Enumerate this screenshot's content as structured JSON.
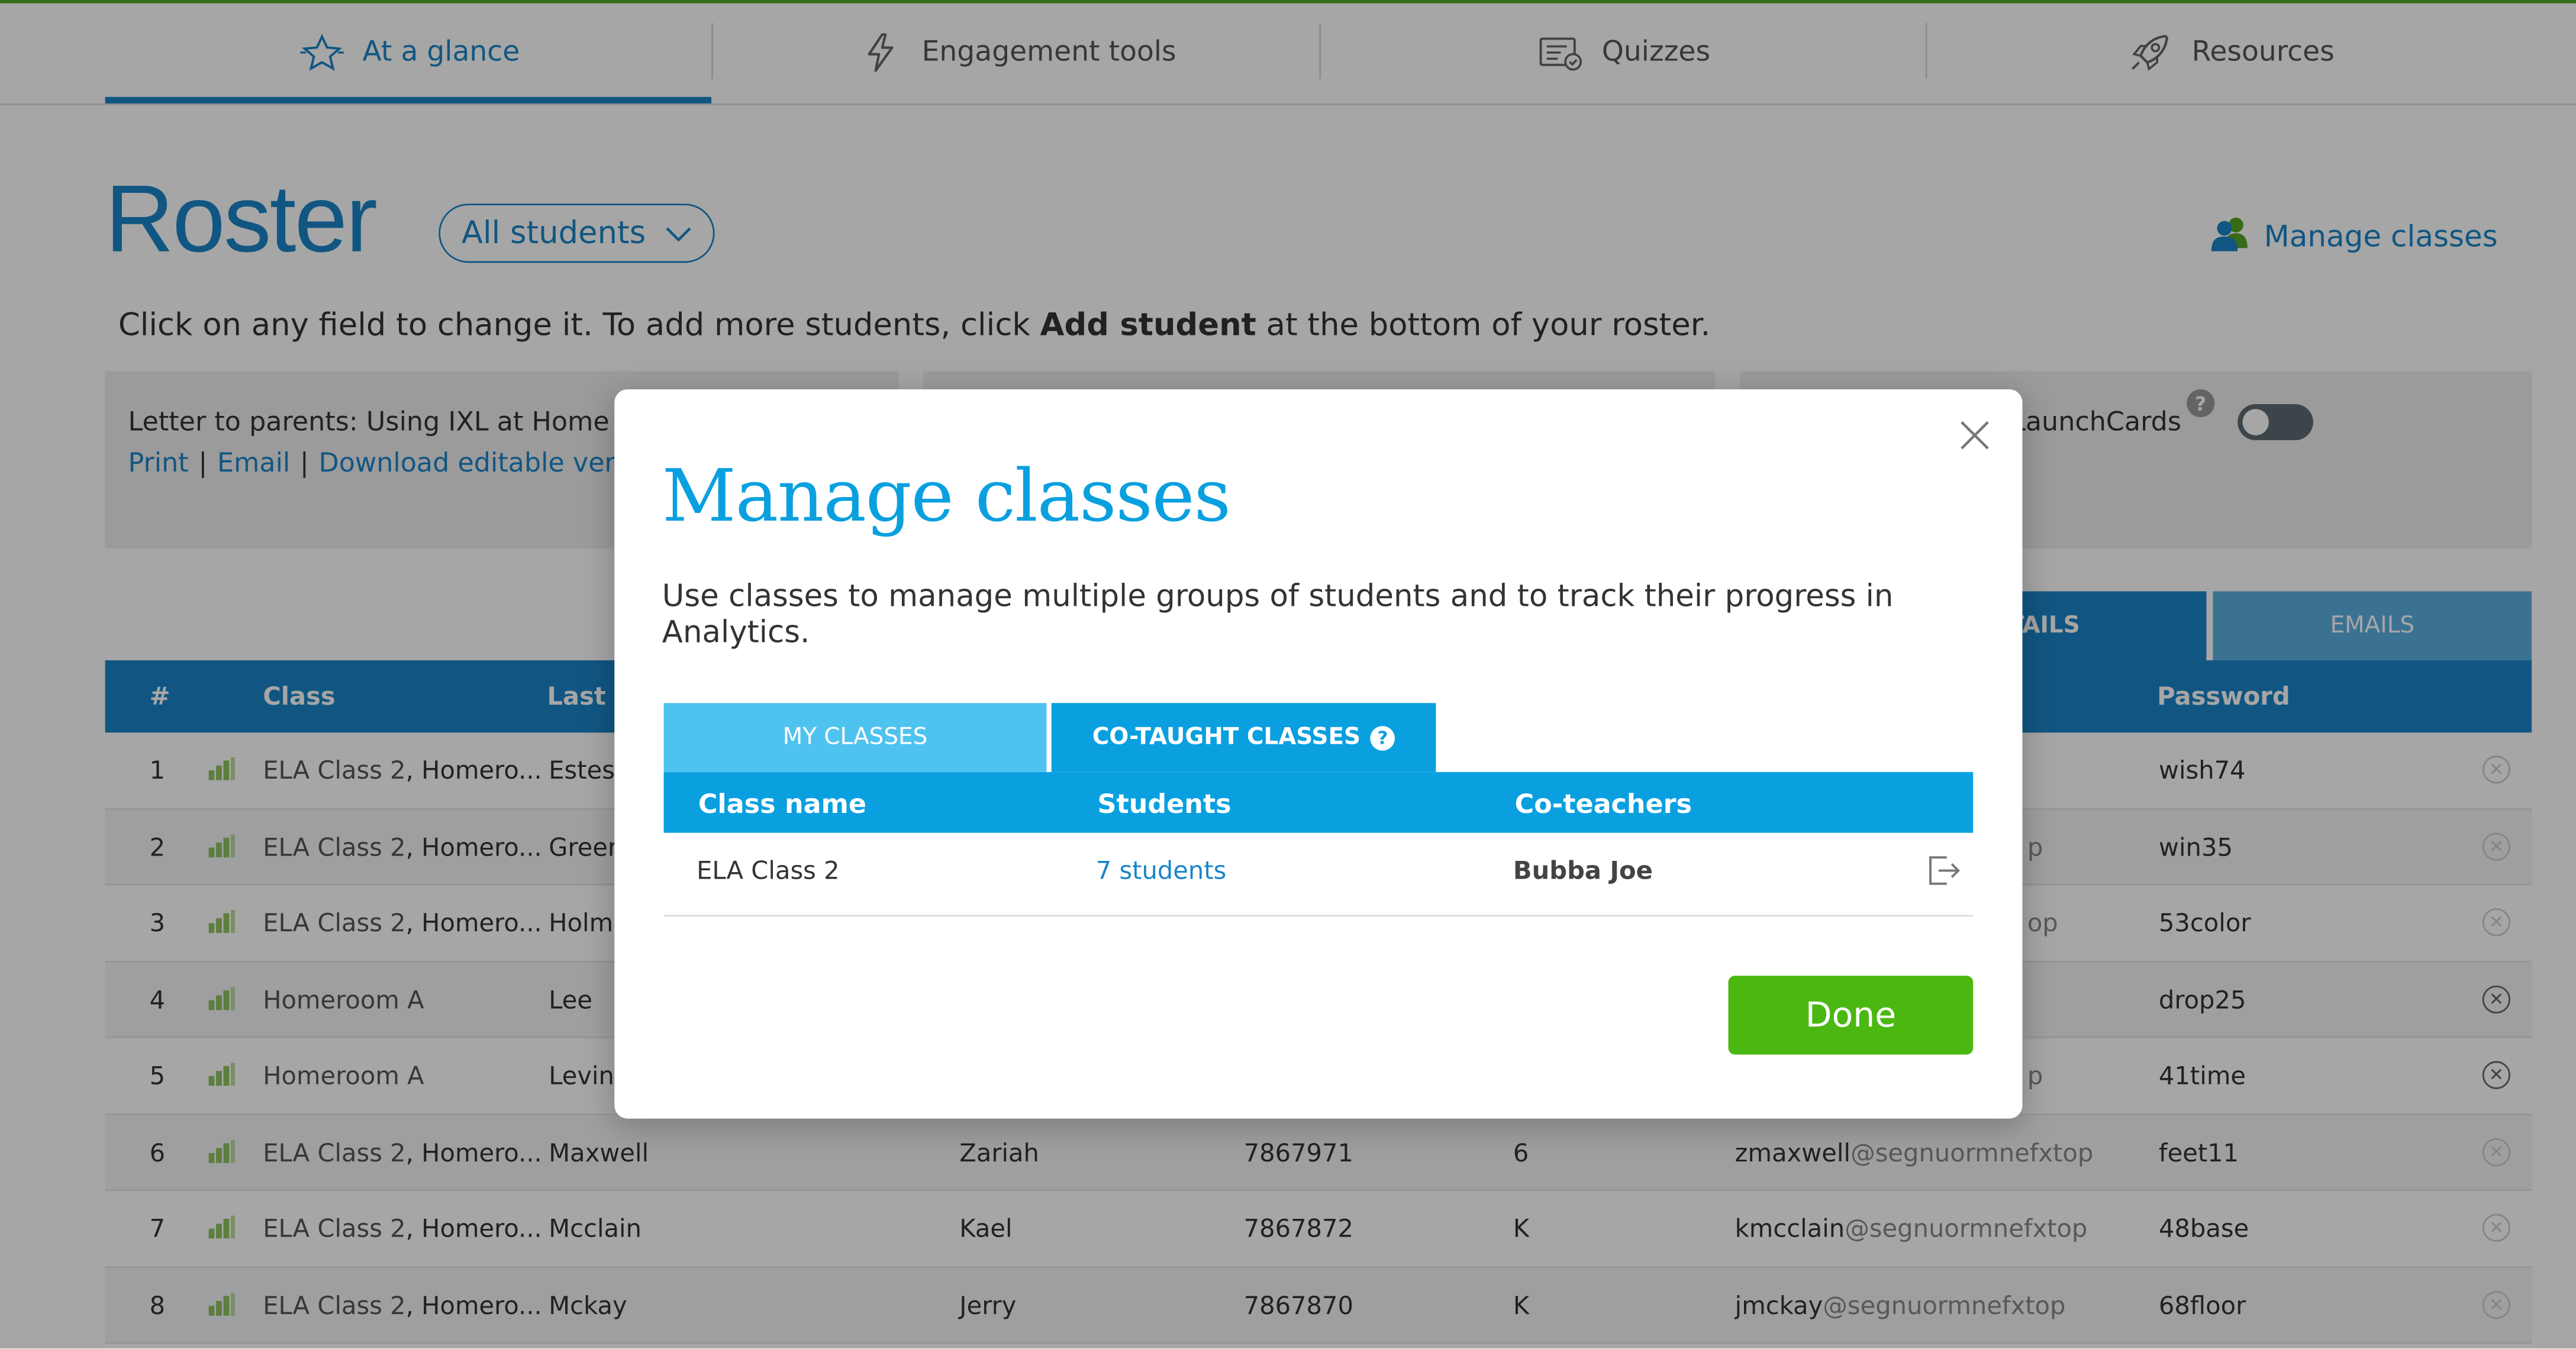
{
  "nav": {
    "tabs": [
      {
        "label": "At a glance",
        "icon": "star-badge-icon",
        "active": true
      },
      {
        "label": "Engagement tools",
        "icon": "lightning-icon",
        "active": false
      },
      {
        "label": "Quizzes",
        "icon": "quiz-icon",
        "active": false
      },
      {
        "label": "Resources",
        "icon": "rocket-icon",
        "active": false
      }
    ]
  },
  "page": {
    "title": "Roster",
    "filter_label": "All students",
    "manage_classes_label": "Manage classes",
    "instructions_before": "Click on any field to change it. To add more students, click ",
    "instructions_bold": "Add student",
    "instructions_after": " at the bottom of your roster."
  },
  "info": {
    "letter_label": "Letter to parents: Using IXL at Home",
    "print": "Print",
    "email": "Email",
    "download": "Download editable version",
    "launchcards": "LaunchCards",
    "help": "?"
  },
  "subtabs": {
    "details": "STUDENT DETAILS",
    "emails": "EMAILS"
  },
  "table": {
    "headers": {
      "num": "#",
      "class": "Class",
      "last": "Last name",
      "password": "Password"
    },
    "rows": [
      {
        "num": "1",
        "class_a": "ELA Class 2",
        "class_b": ", Homero...",
        "last": "Estes",
        "first": "",
        "id": "",
        "grade": "",
        "user": "",
        "dom": "",
        "password": "wish74"
      },
      {
        "num": "2",
        "class_a": "ELA Class 2",
        "class_b": ", Homero...",
        "last": "Green",
        "first": "",
        "id": "",
        "grade": "",
        "user": "",
        "dom": "p",
        "password": "win35"
      },
      {
        "num": "3",
        "class_a": "ELA Class 2",
        "class_b": ", Homero...",
        "last": "Holme",
        "first": "",
        "id": "",
        "grade": "",
        "user": "",
        "dom": "op",
        "password": "53color"
      },
      {
        "num": "4",
        "class_a": "Homeroom A",
        "class_b": "",
        "last": "Lee",
        "first": "",
        "id": "",
        "grade": "",
        "user": "",
        "dom": "",
        "password": "drop25"
      },
      {
        "num": "5",
        "class_a": "Homeroom A",
        "class_b": "",
        "last": "Levine",
        "first": "",
        "id": "",
        "grade": "",
        "user": "",
        "dom": "p",
        "password": "41time"
      },
      {
        "num": "6",
        "class_a": "ELA Class 2",
        "class_b": ", Homero...",
        "last": "Maxwell",
        "first": "Zariah",
        "id": "7867971",
        "grade": "6",
        "user": "zmaxwell",
        "dom": "@segnuormnefxtop",
        "password": "feet11"
      },
      {
        "num": "7",
        "class_a": "ELA Class 2",
        "class_b": ", Homero...",
        "last": "Mcclain",
        "first": "Kael",
        "id": "7867872",
        "grade": "K",
        "user": "kmcclain",
        "dom": "@segnuormnefxtop",
        "password": "48base"
      },
      {
        "num": "8",
        "class_a": "ELA Class 2",
        "class_b": ", Homero...",
        "last": "Mckay",
        "first": "Jerry",
        "id": "7867870",
        "grade": "K",
        "user": "jmckay",
        "dom": "@segnuormnefxtop",
        "password": "68floor"
      }
    ]
  },
  "modal": {
    "title": "Manage classes",
    "description": "Use classes to manage multiple groups of students and to track their progress in Analytics.",
    "tab_my": "MY CLASSES",
    "tab_cotaught": "CO-TAUGHT CLASSES",
    "tab_help": "?",
    "col_class": "Class name",
    "col_students": "Students",
    "col_coteachers": "Co-teachers",
    "row": {
      "class": "ELA Class 2",
      "students": "7 students",
      "coteacher": "Bubba Joe"
    },
    "done": "Done"
  }
}
